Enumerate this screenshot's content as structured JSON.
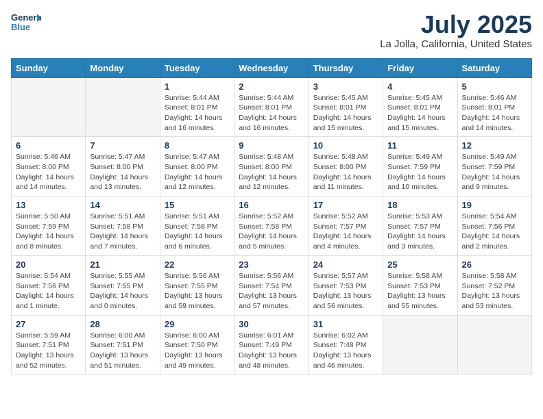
{
  "logo": {
    "line1": "General",
    "line2": "Blue"
  },
  "title": "July 2025",
  "location": "La Jolla, California, United States",
  "weekdays": [
    "Sunday",
    "Monday",
    "Tuesday",
    "Wednesday",
    "Thursday",
    "Friday",
    "Saturday"
  ],
  "weeks": [
    [
      {
        "day": "",
        "info": ""
      },
      {
        "day": "",
        "info": ""
      },
      {
        "day": "1",
        "info": "Sunrise: 5:44 AM\nSunset: 8:01 PM\nDaylight: 14 hours and 16 minutes."
      },
      {
        "day": "2",
        "info": "Sunrise: 5:44 AM\nSunset: 8:01 PM\nDaylight: 14 hours and 16 minutes."
      },
      {
        "day": "3",
        "info": "Sunrise: 5:45 AM\nSunset: 8:01 PM\nDaylight: 14 hours and 15 minutes."
      },
      {
        "day": "4",
        "info": "Sunrise: 5:45 AM\nSunset: 8:01 PM\nDaylight: 14 hours and 15 minutes."
      },
      {
        "day": "5",
        "info": "Sunrise: 5:46 AM\nSunset: 8:01 PM\nDaylight: 14 hours and 14 minutes."
      }
    ],
    [
      {
        "day": "6",
        "info": "Sunrise: 5:46 AM\nSunset: 8:00 PM\nDaylight: 14 hours and 14 minutes."
      },
      {
        "day": "7",
        "info": "Sunrise: 5:47 AM\nSunset: 8:00 PM\nDaylight: 14 hours and 13 minutes."
      },
      {
        "day": "8",
        "info": "Sunrise: 5:47 AM\nSunset: 8:00 PM\nDaylight: 14 hours and 12 minutes."
      },
      {
        "day": "9",
        "info": "Sunrise: 5:48 AM\nSunset: 8:00 PM\nDaylight: 14 hours and 12 minutes."
      },
      {
        "day": "10",
        "info": "Sunrise: 5:48 AM\nSunset: 8:00 PM\nDaylight: 14 hours and 11 minutes."
      },
      {
        "day": "11",
        "info": "Sunrise: 5:49 AM\nSunset: 7:59 PM\nDaylight: 14 hours and 10 minutes."
      },
      {
        "day": "12",
        "info": "Sunrise: 5:49 AM\nSunset: 7:59 PM\nDaylight: 14 hours and 9 minutes."
      }
    ],
    [
      {
        "day": "13",
        "info": "Sunrise: 5:50 AM\nSunset: 7:59 PM\nDaylight: 14 hours and 8 minutes."
      },
      {
        "day": "14",
        "info": "Sunrise: 5:51 AM\nSunset: 7:58 PM\nDaylight: 14 hours and 7 minutes."
      },
      {
        "day": "15",
        "info": "Sunrise: 5:51 AM\nSunset: 7:58 PM\nDaylight: 14 hours and 6 minutes."
      },
      {
        "day": "16",
        "info": "Sunrise: 5:52 AM\nSunset: 7:58 PM\nDaylight: 14 hours and 5 minutes."
      },
      {
        "day": "17",
        "info": "Sunrise: 5:52 AM\nSunset: 7:57 PM\nDaylight: 14 hours and 4 minutes."
      },
      {
        "day": "18",
        "info": "Sunrise: 5:53 AM\nSunset: 7:57 PM\nDaylight: 14 hours and 3 minutes."
      },
      {
        "day": "19",
        "info": "Sunrise: 5:54 AM\nSunset: 7:56 PM\nDaylight: 14 hours and 2 minutes."
      }
    ],
    [
      {
        "day": "20",
        "info": "Sunrise: 5:54 AM\nSunset: 7:56 PM\nDaylight: 14 hours and 1 minute."
      },
      {
        "day": "21",
        "info": "Sunrise: 5:55 AM\nSunset: 7:55 PM\nDaylight: 14 hours and 0 minutes."
      },
      {
        "day": "22",
        "info": "Sunrise: 5:56 AM\nSunset: 7:55 PM\nDaylight: 13 hours and 59 minutes."
      },
      {
        "day": "23",
        "info": "Sunrise: 5:56 AM\nSunset: 7:54 PM\nDaylight: 13 hours and 57 minutes."
      },
      {
        "day": "24",
        "info": "Sunrise: 5:57 AM\nSunset: 7:53 PM\nDaylight: 13 hours and 56 minutes."
      },
      {
        "day": "25",
        "info": "Sunrise: 5:58 AM\nSunset: 7:53 PM\nDaylight: 13 hours and 55 minutes."
      },
      {
        "day": "26",
        "info": "Sunrise: 5:58 AM\nSunset: 7:52 PM\nDaylight: 13 hours and 53 minutes."
      }
    ],
    [
      {
        "day": "27",
        "info": "Sunrise: 5:59 AM\nSunset: 7:51 PM\nDaylight: 13 hours and 52 minutes."
      },
      {
        "day": "28",
        "info": "Sunrise: 6:00 AM\nSunset: 7:51 PM\nDaylight: 13 hours and 51 minutes."
      },
      {
        "day": "29",
        "info": "Sunrise: 6:00 AM\nSunset: 7:50 PM\nDaylight: 13 hours and 49 minutes."
      },
      {
        "day": "30",
        "info": "Sunrise: 6:01 AM\nSunset: 7:49 PM\nDaylight: 13 hours and 48 minutes."
      },
      {
        "day": "31",
        "info": "Sunrise: 6:02 AM\nSunset: 7:48 PM\nDaylight: 13 hours and 46 minutes."
      },
      {
        "day": "",
        "info": ""
      },
      {
        "day": "",
        "info": ""
      }
    ]
  ]
}
